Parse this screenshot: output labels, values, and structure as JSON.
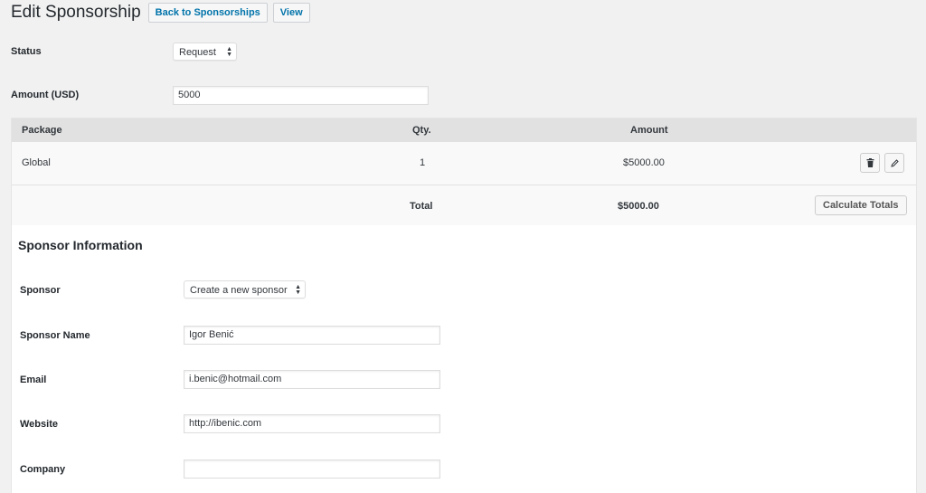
{
  "header": {
    "title": "Edit Sponsorship",
    "back_label": "Back to Sponsorships",
    "view_label": "View"
  },
  "status": {
    "label": "Status",
    "value": "Request"
  },
  "amount": {
    "label": "Amount (USD)",
    "value": "5000"
  },
  "items": {
    "headers": {
      "package": "Package",
      "qty": "Qty.",
      "amount": "Amount"
    },
    "rows": [
      {
        "package": "Global",
        "qty": "1",
        "amount": "$5000.00"
      }
    ],
    "total_label": "Total",
    "total_value": "$5000.00",
    "calculate_label": "Calculate Totals"
  },
  "sponsor_info": {
    "title": "Sponsor Information",
    "sponsor": {
      "label": "Sponsor",
      "value": "Create a new sponsor"
    },
    "name": {
      "label": "Sponsor Name",
      "value": "Igor Benić"
    },
    "email": {
      "label": "Email",
      "value": "i.benic@hotmail.com"
    },
    "website": {
      "label": "Website",
      "value": "http://ibenic.com"
    },
    "company": {
      "label": "Company",
      "value": ""
    }
  },
  "icons": {
    "delete": "trash-icon",
    "edit": "pencil-icon",
    "select_arrows": "up-down-arrows-icon"
  },
  "colors": {
    "link": "#0073aa",
    "background": "#f1f1f1",
    "table_header": "#e1e1e1"
  }
}
